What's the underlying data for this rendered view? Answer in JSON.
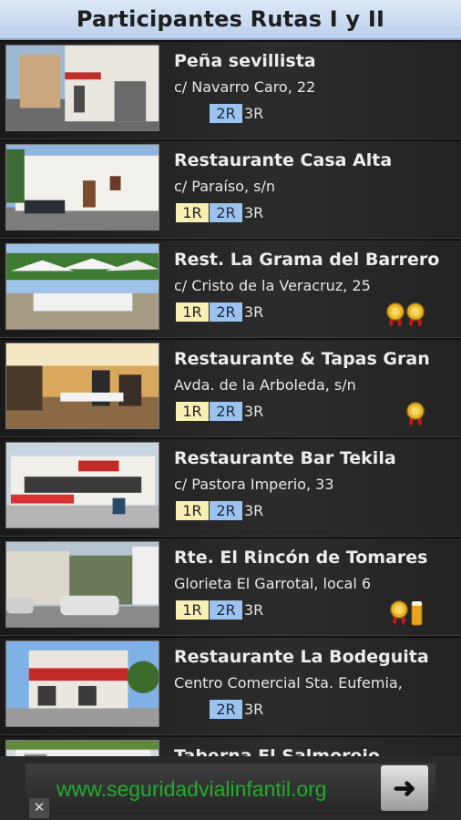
{
  "header": {
    "title": "Participantes Rutas I y II"
  },
  "restaurants": [
    {
      "name": "Peña sevillista",
      "address": "c/ Navarro Caro, 22",
      "badge1": "",
      "badge2": "2R",
      "badge3": "3R",
      "awards": []
    },
    {
      "name": "Restaurante Casa Alta",
      "address": "c/ Paraíso, s/n",
      "badge1": "1R",
      "badge2": "2R",
      "badge3": "3R",
      "awards": []
    },
    {
      "name": "Rest. La Grama del Barrero",
      "address": "c/ Cristo de la Veracruz, 25",
      "badge1": "1R",
      "badge2": "2R",
      "badge3": "3R",
      "awards": [
        "medal-icon",
        "medal-icon"
      ]
    },
    {
      "name": "Restaurante & Tapas Gran",
      "address": "Avda. de la Arboleda, s/n",
      "badge1": "1R",
      "badge2": "2R",
      "badge3": "3R",
      "awards": [
        "medal-icon"
      ]
    },
    {
      "name": "Restaurante Bar Tekila",
      "address": "c/ Pastora Imperio, 33",
      "badge1": "1R",
      "badge2": "2R",
      "badge3": "3R",
      "awards": []
    },
    {
      "name": "Rte. El Rincón de Tomares",
      "address": "Glorieta El Garrotal, local 6",
      "badge1": "1R",
      "badge2": "2R",
      "badge3": "3R",
      "awards": [
        "medal-icon",
        "beer-icon"
      ]
    },
    {
      "name": "Restaurante La Bodeguita",
      "address": "Centro Comercial Sta. Eufemia,",
      "badge1": "",
      "badge2": "2R",
      "badge3": "3R",
      "awards": []
    },
    {
      "name": "Taberna El Salmorejo",
      "address": "",
      "badge1": "",
      "badge2": "",
      "badge3": "",
      "awards": []
    }
  ],
  "ad": {
    "text": "www.seguridadvialinfantil.org",
    "arrow": "➜",
    "close": "✕"
  },
  "colors": {
    "badge1": "#f9efb5",
    "badge2": "#9cc2f0",
    "header": "#c8d8f0",
    "ad_text": "#1fae2a"
  }
}
